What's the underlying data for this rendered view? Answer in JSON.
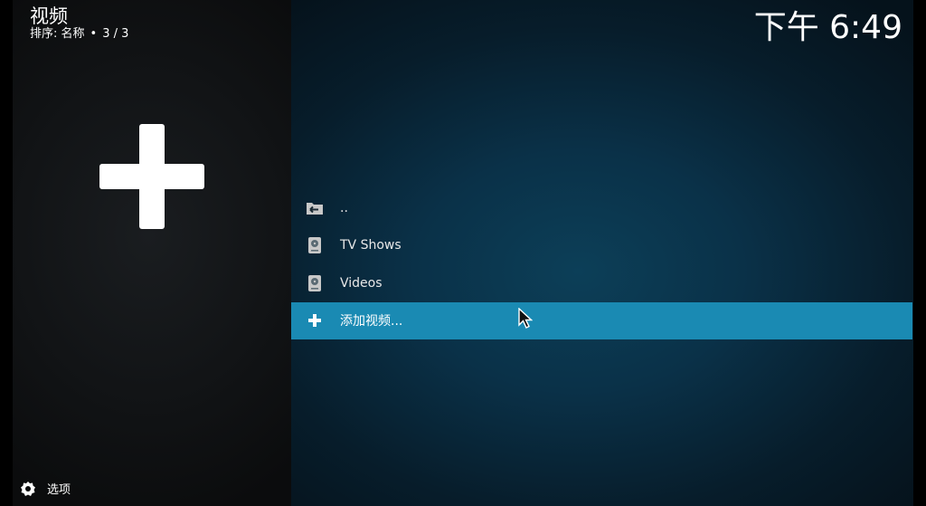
{
  "header": {
    "title": "视频",
    "sort_label": "排序: 名称",
    "separator": "•",
    "position": "3 / 3",
    "clock": "下午 6:49"
  },
  "left_panel": {
    "thumbnail_icon": "plus-icon"
  },
  "list": {
    "items": [
      {
        "label": "..",
        "icon": "folder-back-icon",
        "selected": false
      },
      {
        "label": "TV Shows",
        "icon": "hard-drive-icon",
        "selected": false
      },
      {
        "label": "Videos",
        "icon": "hard-drive-icon",
        "selected": false
      },
      {
        "label": "添加视频...",
        "icon": "plus-icon",
        "selected": true
      }
    ]
  },
  "footer": {
    "options_label": "选项",
    "options_icon": "gear-icon"
  },
  "colors": {
    "selected_row": "#1a8ab3",
    "text": "#ffffff"
  }
}
